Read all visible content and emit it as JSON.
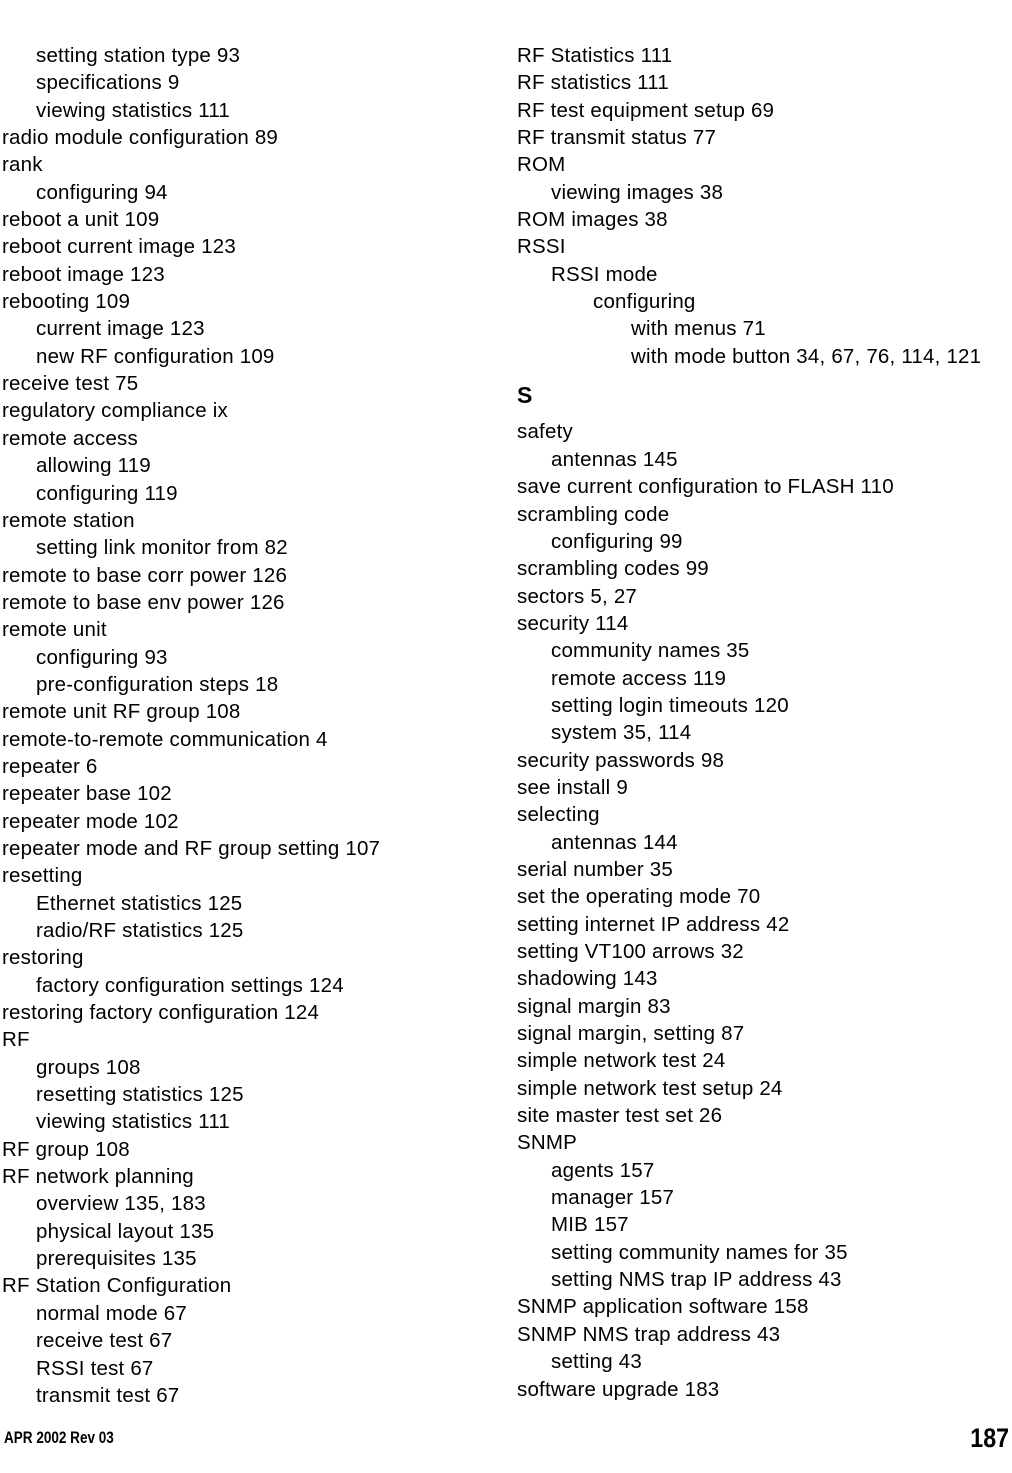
{
  "document": {
    "page_number": "187",
    "footer_note": "APR 2002 Rev 03"
  },
  "index": {
    "left_column": [
      {
        "level": 1,
        "text": "setting station type 93"
      },
      {
        "level": 1,
        "text": "specifications 9"
      },
      {
        "level": 1,
        "text": "viewing statistics 111"
      },
      {
        "level": 0,
        "text": "radio module configuration 89"
      },
      {
        "level": 0,
        "text": "rank"
      },
      {
        "level": 1,
        "text": "configuring 94"
      },
      {
        "level": 0,
        "text": "reboot a unit 109"
      },
      {
        "level": 0,
        "text": "reboot current image 123"
      },
      {
        "level": 0,
        "text": "reboot image 123"
      },
      {
        "level": 0,
        "text": "rebooting 109"
      },
      {
        "level": 1,
        "text": "current image 123"
      },
      {
        "level": 1,
        "text": "new RF configuration 109"
      },
      {
        "level": 0,
        "text": "receive test 75"
      },
      {
        "level": 0,
        "text": "regulatory compliance ix"
      },
      {
        "level": 0,
        "text": "remote access"
      },
      {
        "level": 1,
        "text": "allowing 119"
      },
      {
        "level": 1,
        "text": "configuring 119"
      },
      {
        "level": 0,
        "text": "remote station"
      },
      {
        "level": 1,
        "text": "setting link monitor from 82"
      },
      {
        "level": 0,
        "text": "remote to base corr power 126"
      },
      {
        "level": 0,
        "text": "remote to base env power 126"
      },
      {
        "level": 0,
        "text": "remote unit"
      },
      {
        "level": 1,
        "text": "configuring 93"
      },
      {
        "level": 1,
        "text": "pre-configuration steps 18"
      },
      {
        "level": 0,
        "text": "remote unit RF group 108"
      },
      {
        "level": 0,
        "text": "remote-to-remote communication 4"
      },
      {
        "level": 0,
        "text": "repeater 6"
      },
      {
        "level": 0,
        "text": "repeater base 102"
      },
      {
        "level": 0,
        "text": "repeater mode 102"
      },
      {
        "level": 0,
        "text": "repeater mode and RF group setting 107"
      },
      {
        "level": 0,
        "text": "resetting"
      },
      {
        "level": 1,
        "text": "Ethernet statistics 125"
      },
      {
        "level": 1,
        "text": "radio/RF statistics 125"
      },
      {
        "level": 0,
        "text": "restoring"
      },
      {
        "level": 1,
        "text": "factory configuration settings 124"
      },
      {
        "level": 0,
        "text": "restoring factory configuration 124"
      },
      {
        "level": 0,
        "text": "RF"
      },
      {
        "level": 1,
        "text": "groups 108"
      },
      {
        "level": 1,
        "text": "resetting statistics 125"
      },
      {
        "level": 1,
        "text": "viewing statistics 111"
      },
      {
        "level": 0,
        "text": "RF group 108"
      },
      {
        "level": 0,
        "text": "RF network planning"
      },
      {
        "level": 1,
        "text": "overview 135, 183"
      },
      {
        "level": 1,
        "text": "physical layout 135"
      },
      {
        "level": 1,
        "text": "prerequisites 135"
      },
      {
        "level": 0,
        "text": "RF Station Configuration"
      },
      {
        "level": 1,
        "text": "normal mode 67"
      },
      {
        "level": 1,
        "text": "receive test 67"
      },
      {
        "level": 1,
        "text": "RSSI test 67"
      },
      {
        "level": 1,
        "text": "transmit test 67"
      }
    ],
    "right_column": [
      {
        "level": 0,
        "text": "RF Statistics 111"
      },
      {
        "level": 0,
        "text": "RF statistics 111"
      },
      {
        "level": 0,
        "text": "RF test equipment setup 69"
      },
      {
        "level": 0,
        "text": "RF transmit status 77"
      },
      {
        "level": 0,
        "text": "ROM"
      },
      {
        "level": 1,
        "text": "viewing images 38"
      },
      {
        "level": 0,
        "text": "ROM images 38"
      },
      {
        "level": 0,
        "text": "RSSI"
      },
      {
        "level": 1,
        "text": "RSSI mode"
      },
      {
        "level": 2,
        "text": "configuring"
      },
      {
        "level": 3,
        "text": "with menus 71"
      },
      {
        "level": 3,
        "text": "with mode button 34, 67, 76, 114, 121"
      },
      {
        "heading": "S"
      },
      {
        "level": 0,
        "text": "safety"
      },
      {
        "level": 1,
        "text": "antennas 145"
      },
      {
        "level": 0,
        "text": "save current configuration to FLASH 110"
      },
      {
        "level": 0,
        "text": "scrambling code"
      },
      {
        "level": 1,
        "text": "configuring 99"
      },
      {
        "level": 0,
        "text": "scrambling codes 99"
      },
      {
        "level": 0,
        "text": "sectors 5, 27"
      },
      {
        "level": 0,
        "text": "security 114"
      },
      {
        "level": 1,
        "text": "community names 35"
      },
      {
        "level": 1,
        "text": "remote access 119"
      },
      {
        "level": 1,
        "text": "setting login timeouts 120"
      },
      {
        "level": 1,
        "text": "system 35, 114"
      },
      {
        "level": 0,
        "text": "security passwords 98"
      },
      {
        "level": 0,
        "text": "see install 9"
      },
      {
        "level": 0,
        "text": "selecting"
      },
      {
        "level": 1,
        "text": "antennas 144"
      },
      {
        "level": 0,
        "text": "serial number 35"
      },
      {
        "level": 0,
        "text": "set the operating mode 70"
      },
      {
        "level": 0,
        "text": "setting internet IP address 42"
      },
      {
        "level": 0,
        "text": "setting VT100 arrows 32"
      },
      {
        "level": 0,
        "text": "shadowing 143"
      },
      {
        "level": 0,
        "text": "signal margin 83"
      },
      {
        "level": 0,
        "text": "signal margin, setting 87"
      },
      {
        "level": 0,
        "text": "simple network test 24"
      },
      {
        "level": 0,
        "text": "simple network test setup 24"
      },
      {
        "level": 0,
        "text": "site master test set 26"
      },
      {
        "level": 0,
        "text": "SNMP"
      },
      {
        "level": 1,
        "text": "agents 157"
      },
      {
        "level": 1,
        "text": "manager 157"
      },
      {
        "level": 1,
        "text": "MIB 157"
      },
      {
        "level": 1,
        "text": "setting community names for 35"
      },
      {
        "level": 1,
        "text": "setting NMS trap IP address 43"
      },
      {
        "level": 0,
        "text": "SNMP application software 158"
      },
      {
        "level": 0,
        "text": "SNMP NMS trap address 43"
      },
      {
        "level": 1,
        "text": "setting 43"
      },
      {
        "level": 0,
        "text": "software upgrade 183"
      }
    ]
  }
}
